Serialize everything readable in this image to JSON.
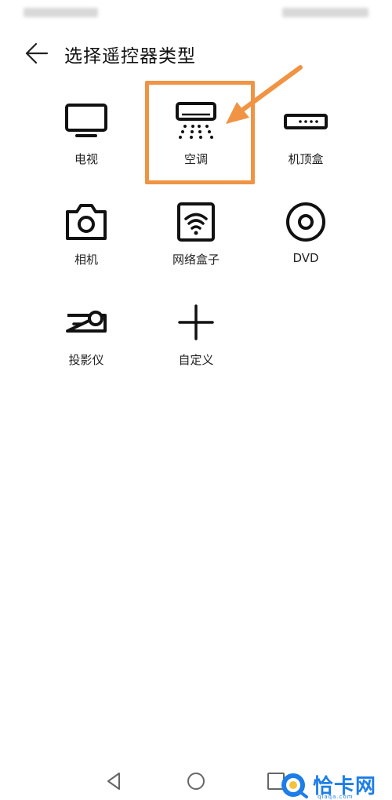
{
  "header": {
    "title": "选择遥控器类型"
  },
  "devices": [
    {
      "label": "电视",
      "icon": "tv-icon"
    },
    {
      "label": "空调",
      "icon": "air-conditioner-icon",
      "highlighted": true
    },
    {
      "label": "机顶盒",
      "icon": "set-top-box-icon"
    },
    {
      "label": "相机",
      "icon": "camera-icon"
    },
    {
      "label": "网络盒子",
      "icon": "wifi-box-icon"
    },
    {
      "label": "DVD",
      "icon": "dvd-icon"
    },
    {
      "label": "投影仪",
      "icon": "projector-icon"
    },
    {
      "label": "自定义",
      "icon": "plus-icon"
    }
  ],
  "nav": {
    "back": "triangle-back-icon",
    "home": "circle-home-icon",
    "recent": "square-recent-icon"
  },
  "watermark": {
    "brand": "恰卡网",
    "domain": "qiaqa.com"
  },
  "colors": {
    "highlight": "#f09444",
    "watermark": "#1d7ee8"
  }
}
